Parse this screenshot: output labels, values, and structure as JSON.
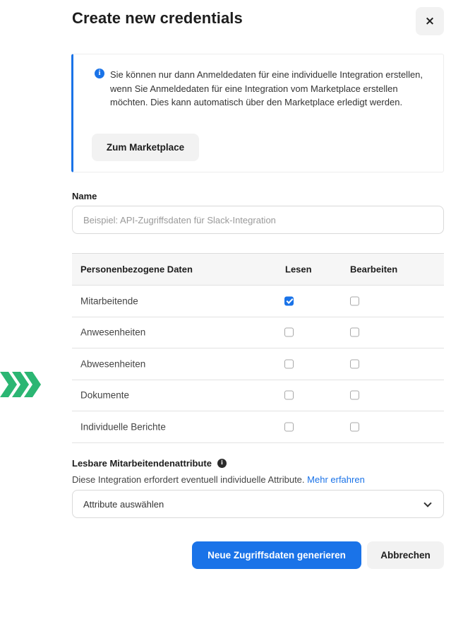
{
  "dialog": {
    "title": "Create new credentials",
    "close_label": "×"
  },
  "info": {
    "icon": "info-icon",
    "icon_glyph": "i",
    "text": "Sie können nur dann Anmeldedaten für eine individuelle Integration erstellen, wenn Sie Anmeldedaten für eine Integration vom Marketplace erstellen möchten. Dies kann automatisch über den Marketplace erledigt werden.",
    "button_label": "Zum Marketplace",
    "accent_color": "#1a73e8"
  },
  "name_field": {
    "label": "Name",
    "value": "",
    "placeholder": "Beispiel: API-Zugriffsdaten für Slack-Integration"
  },
  "permissions": {
    "headers": [
      "Personenbezogene Daten",
      "Lesen",
      "Bearbeiten"
    ],
    "rows": [
      {
        "label": "Mitarbeitende",
        "read": true,
        "edit": false
      },
      {
        "label": "Anwesenheiten",
        "read": false,
        "edit": false
      },
      {
        "label": "Abwesenheiten",
        "read": false,
        "edit": false
      },
      {
        "label": "Dokumente",
        "read": false,
        "edit": false
      },
      {
        "label": "Individuelle Berichte",
        "read": false,
        "edit": false
      }
    ]
  },
  "attributes": {
    "label": "Lesbare Mitarbeitendenattribute",
    "info_glyph": "i",
    "description": "Diese Integration erfordert eventuell individuelle Attribute.",
    "link_label": "Mehr erfahren",
    "select_value": "Attribute auswählen"
  },
  "actions": {
    "primary_label": "Neue Zugriffsdaten generieren",
    "secondary_label": "Abbrechen",
    "primary_color": "#1a73e8"
  },
  "decoration": {
    "icon": "chevron-triple-right-icon",
    "color": "#2bb673"
  }
}
